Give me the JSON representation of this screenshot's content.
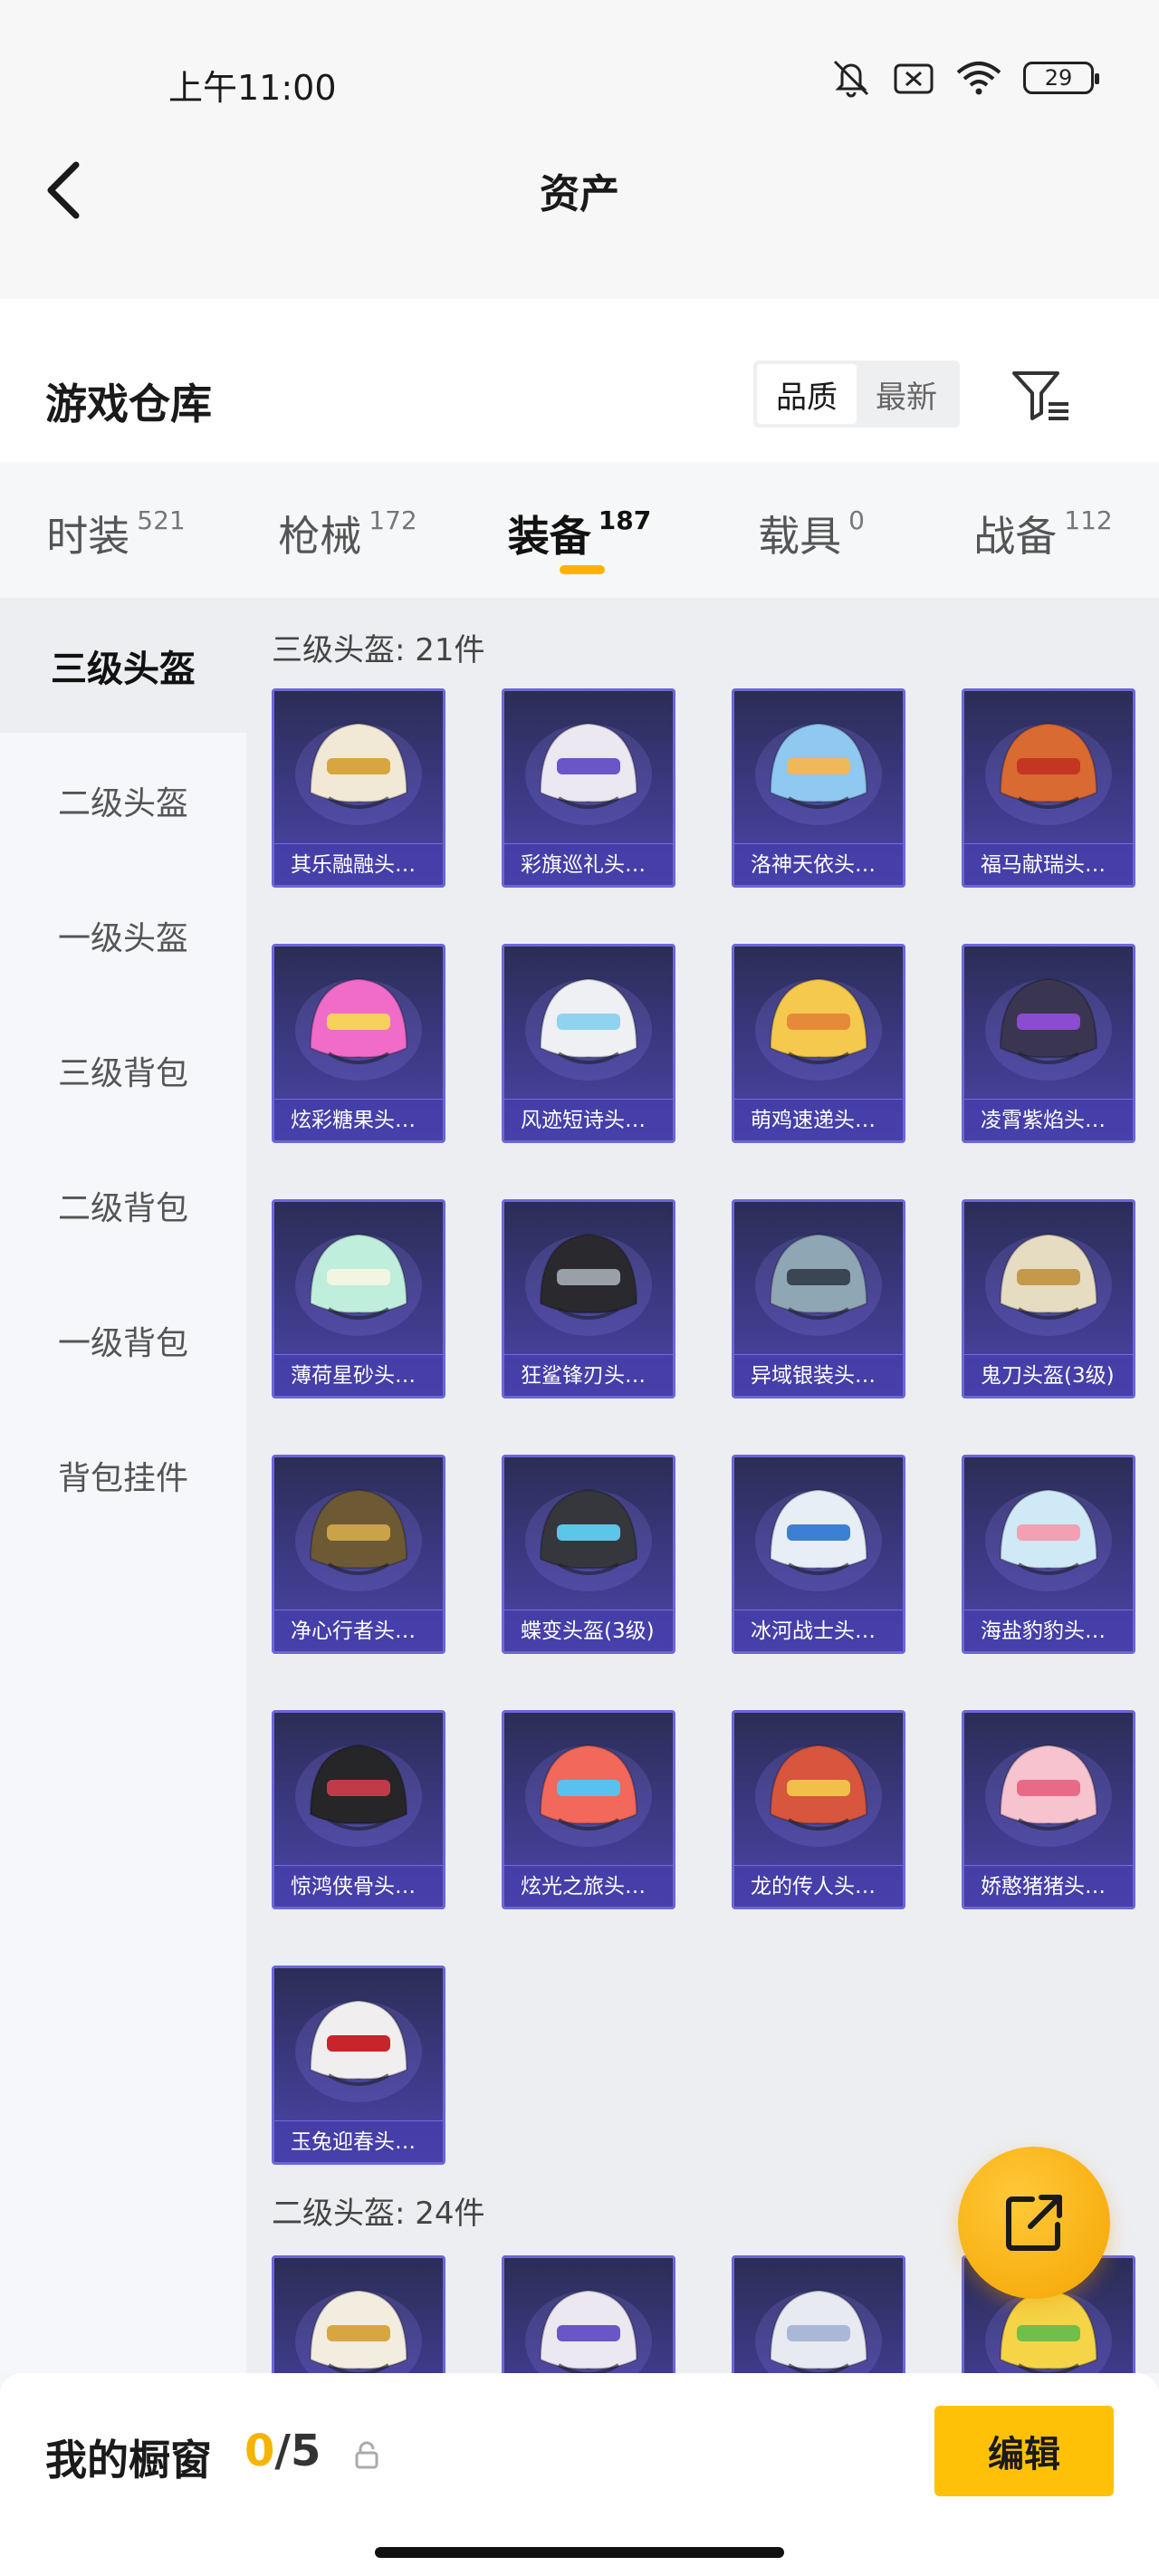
{
  "status": {
    "time": "上午11:00",
    "battery": "29"
  },
  "header": {
    "title": "资产"
  },
  "warehouse": {
    "title": "游戏仓库",
    "sort_options": [
      {
        "label": "品质",
        "active": true
      },
      {
        "label": "最新",
        "active": false
      }
    ]
  },
  "tabs": [
    {
      "label": "时装",
      "count": "521"
    },
    {
      "label": "枪械",
      "count": "172"
    },
    {
      "label": "装备",
      "count": "187",
      "active": true
    },
    {
      "label": "载具",
      "count": "0"
    },
    {
      "label": "战备",
      "count": "112"
    }
  ],
  "sidebar": {
    "items": [
      {
        "label": "三级头盔",
        "active": true
      },
      {
        "label": "二级头盔"
      },
      {
        "label": "一级头盔"
      },
      {
        "label": "三级背包"
      },
      {
        "label": "二级背包"
      },
      {
        "label": "一级背包"
      },
      {
        "label": "背包挂件"
      }
    ]
  },
  "sections": [
    {
      "title": "三级头盔: 21件",
      "items": [
        {
          "name": "其乐融融头…",
          "color": "#f1e9d6",
          "accent": "#d8a640"
        },
        {
          "name": "彩旗巡礼头…",
          "color": "#ece8f2",
          "accent": "#6a56c6"
        },
        {
          "name": "洛神天依头…",
          "color": "#8fc8f0",
          "accent": "#f0b85a"
        },
        {
          "name": "福马献瑞头…",
          "color": "#d96a32",
          "accent": "#c43522"
        },
        {
          "name": "炫彩糖果头…",
          "color": "#f06cc8",
          "accent": "#f7d25a"
        },
        {
          "name": "风迹短诗头…",
          "color": "#eef0f4",
          "accent": "#8fd3f0"
        },
        {
          "name": "萌鸡速递头…",
          "color": "#f5c94d",
          "accent": "#e58a3a"
        },
        {
          "name": "凌霄紫焰头…",
          "color": "#3a3550",
          "accent": "#8b4ccf"
        },
        {
          "name": "薄荷星砂头…",
          "color": "#bfeedd",
          "accent": "#f0f6e0"
        },
        {
          "name": "狂鲨锋刃头…",
          "color": "#2a2a2e",
          "accent": "#9aa0a8"
        },
        {
          "name": "异域银装头…",
          "color": "#8fa6b4",
          "accent": "#3a4652"
        },
        {
          "name": "鬼刀头盔(3级)",
          "color": "#e6dcc2",
          "accent": "#c49a4a"
        },
        {
          "name": "净心行者头…",
          "color": "#6d5a34",
          "accent": "#c9a24a"
        },
        {
          "name": "蝶变头盔(3级)",
          "color": "#35373c",
          "accent": "#5cc6e8"
        },
        {
          "name": "冰河战士头…",
          "color": "#e7eef6",
          "accent": "#3e7fd6"
        },
        {
          "name": "海盐豹豹头…",
          "color": "#cfe9f7",
          "accent": "#f3a0b4"
        },
        {
          "name": "惊鸿侠骨头…",
          "color": "#262528",
          "accent": "#c23a4a"
        },
        {
          "name": "炫光之旅头…",
          "color": "#f2685a",
          "accent": "#59c1f0"
        },
        {
          "name": "龙的传人头…",
          "color": "#d8553e",
          "accent": "#f2c04a"
        },
        {
          "name": "娇憨猪猪头…",
          "color": "#f6c3cf",
          "accent": "#e96a86"
        },
        {
          "name": "玉兔迎春头…",
          "color": "#f1eef0",
          "accent": "#c8242c"
        }
      ]
    },
    {
      "title": "二级头盔: 24件",
      "items": [
        {
          "name": "",
          "color": "#f3ede0",
          "accent": "#d8a640"
        },
        {
          "name": "",
          "color": "#ece8f2",
          "accent": "#6a56c6"
        },
        {
          "name": "",
          "color": "#e8eaf2",
          "accent": "#a9b8d6"
        },
        {
          "name": "",
          "color": "#f5d447",
          "accent": "#6fbf4a"
        }
      ]
    }
  ],
  "showcase": {
    "label": "我的橱窗",
    "current": "0",
    "total": "/5",
    "edit_label": "编辑"
  }
}
